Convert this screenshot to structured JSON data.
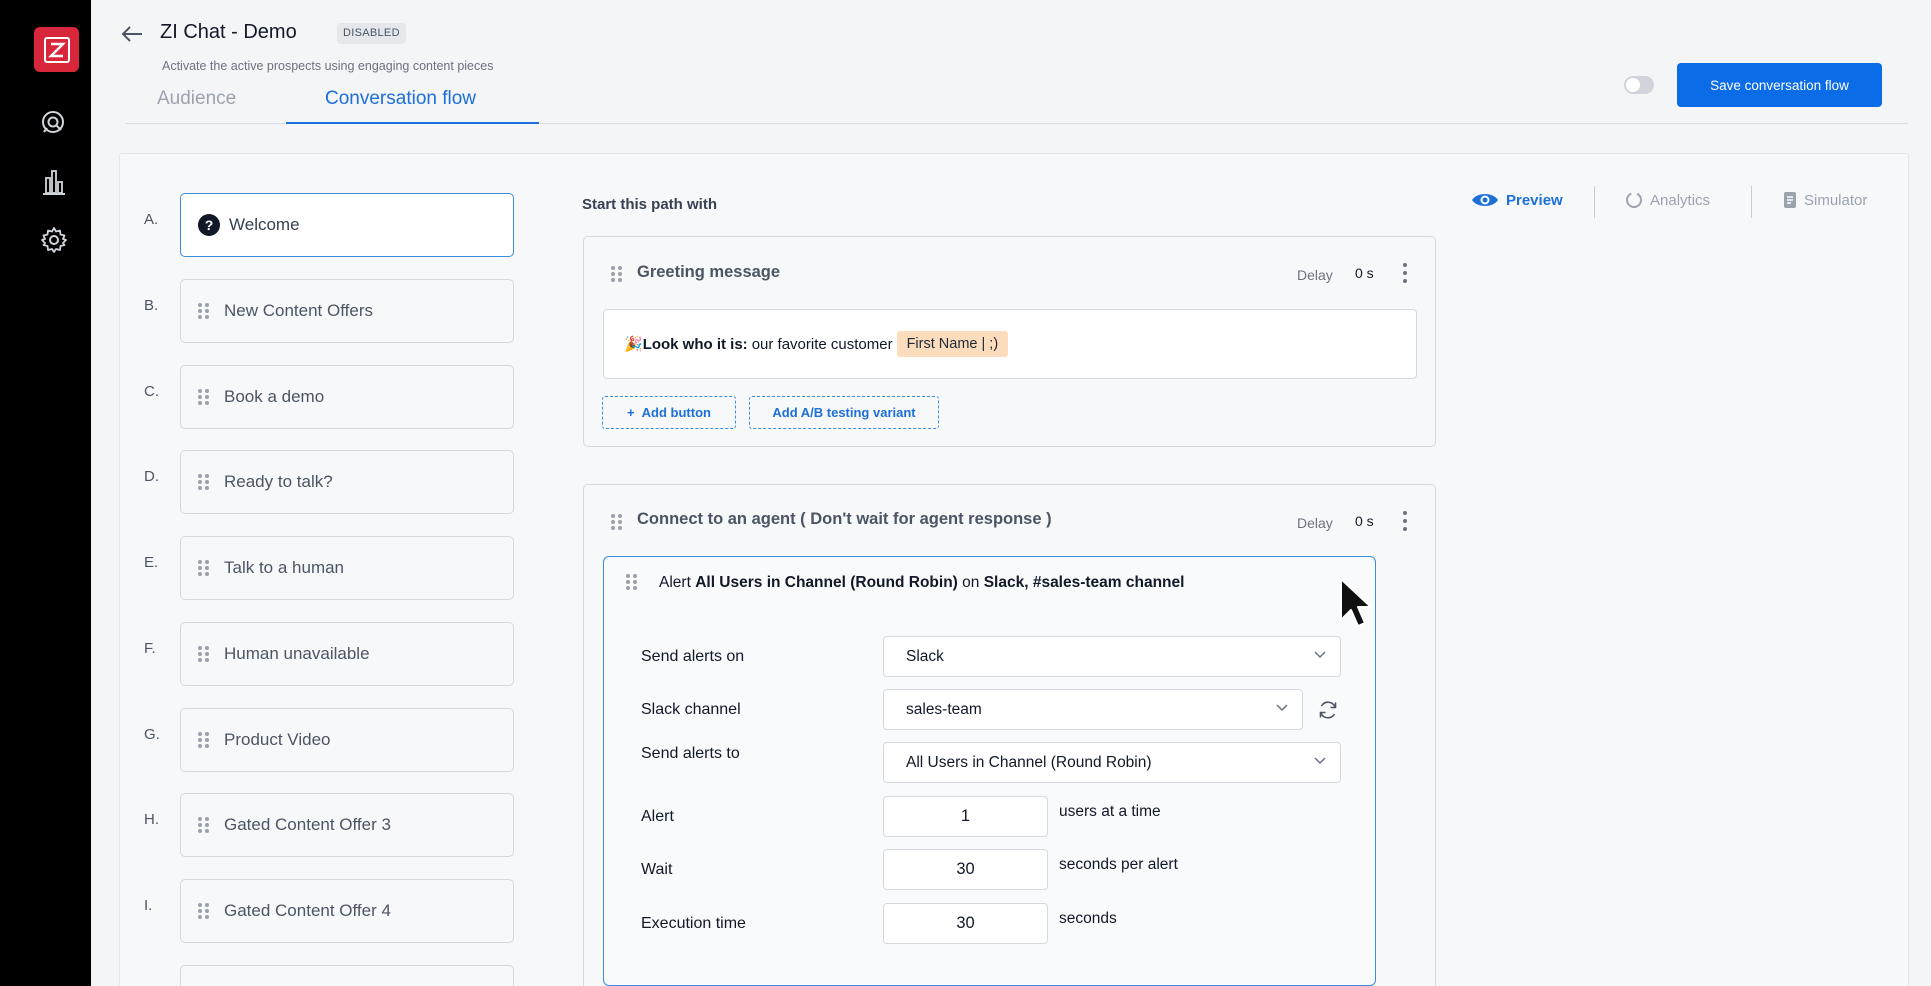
{
  "header": {
    "title": "ZI Chat - Demo",
    "status_badge": "DISABLED",
    "subtitle": "Activate the active prospects using engaging content pieces",
    "tabs": [
      {
        "label": "Audience",
        "active": false
      },
      {
        "label": "Conversation flow",
        "active": true
      }
    ],
    "save_label": "Save conversation flow",
    "toggle_on": false
  },
  "rail": {
    "logo": "Z",
    "icons": [
      "z-logo-icon",
      "chat-search-icon",
      "bar-chart-icon",
      "gear-icon"
    ]
  },
  "paths": [
    {
      "letter": "A.",
      "label": "Welcome",
      "active": true,
      "icon": "question-icon"
    },
    {
      "letter": "B.",
      "label": "New Content Offers"
    },
    {
      "letter": "C.",
      "label": "Book a demo"
    },
    {
      "letter": "D.",
      "label": "Ready to talk?"
    },
    {
      "letter": "E.",
      "label": "Talk to a human"
    },
    {
      "letter": "F.",
      "label": "Human unavailable"
    },
    {
      "letter": "G.",
      "label": "Product Video"
    },
    {
      "letter": "H.",
      "label": "Gated Content Offer 3"
    },
    {
      "letter": "I.",
      "label": "Gated Content Offer 4"
    }
  ],
  "flow": {
    "start_label": "Start this path with",
    "greeting": {
      "title": "Greeting message",
      "delay_label": "Delay",
      "delay_value": "0 s",
      "message_emoji": "🎉",
      "message_bold": "Look who it is:",
      "message_text": "our favorite customer",
      "token": "First Name | ;)",
      "add_button": "Add button",
      "ab_variant": "Add A/B testing variant"
    },
    "agent": {
      "title": "Connect to an agent ( Don't wait for agent response )",
      "delay_label": "Delay",
      "delay_value": "0 s",
      "alert_prefix": "Alert",
      "alert_target": "All Users in Channel (Round Robin)",
      "alert_on": "on",
      "alert_channel": "Slack, #sales-team channel",
      "send_alerts_on_label": "Send alerts on",
      "send_alerts_on_value": "Slack",
      "slack_channel_label": "Slack channel",
      "slack_channel_value": "sales-team",
      "send_alerts_to_label": "Send alerts to",
      "send_alerts_to_value": "All Users in Channel (Round Robin)",
      "alert_label": "Alert",
      "alert_value": "1",
      "alert_suffix": "users at a time",
      "wait_label": "Wait",
      "wait_value": "30",
      "wait_suffix": "seconds per alert",
      "exec_label": "Execution time",
      "exec_value": "30",
      "exec_suffix": "seconds"
    }
  },
  "views": [
    {
      "label": "Preview",
      "active": true,
      "icon": "eye-icon"
    },
    {
      "label": "Analytics",
      "active": false,
      "icon": "analytics-icon"
    },
    {
      "label": "Simulator",
      "active": false,
      "icon": "simulator-icon"
    }
  ],
  "colors": {
    "accent": "#0b6ce8",
    "active_border": "#3b8de0",
    "logo": "#d8263b",
    "token_bg": "#fbdcbc",
    "rail": "#000000"
  }
}
